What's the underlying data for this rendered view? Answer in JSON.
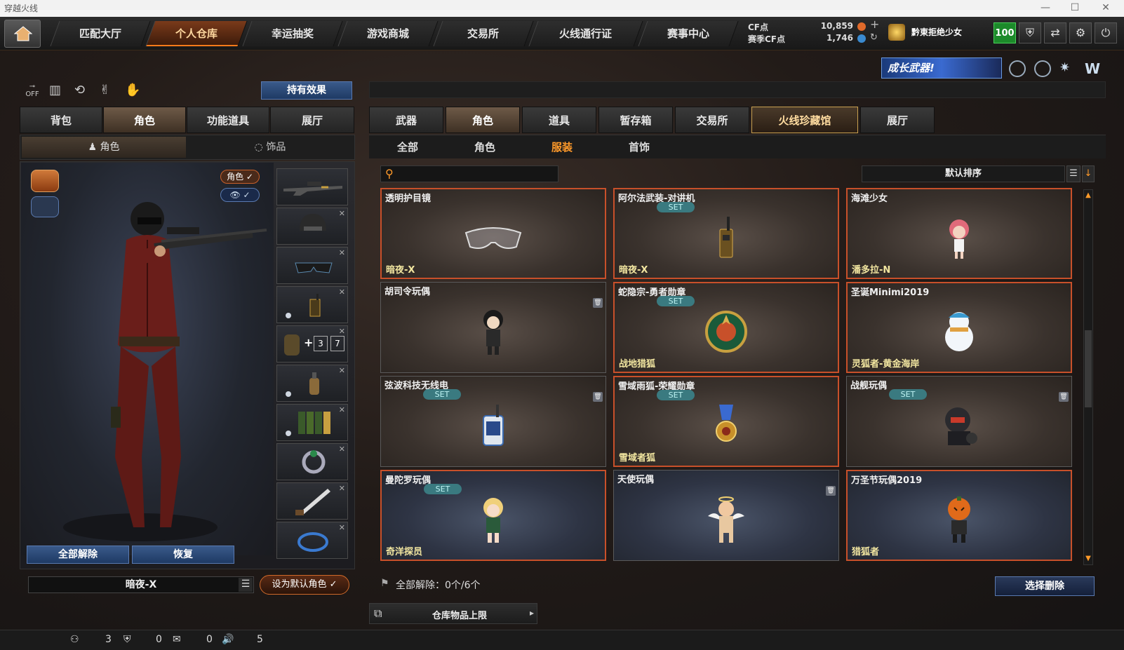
{
  "window": {
    "title": "穿越火线",
    "controls": [
      "—",
      "☐",
      "✕"
    ]
  },
  "nav": {
    "items": [
      "匹配大厅",
      "个人仓库",
      "幸运抽奖",
      "游戏商城",
      "交易所",
      "火线通行证",
      "赛事中心"
    ],
    "active_index": 1
  },
  "currency": {
    "cf_label": "CF点",
    "cf_value": "10,859",
    "season_label": "赛季CF点",
    "season_value": "1,746"
  },
  "user": {
    "name": "黔東拒绝少女",
    "level": "100"
  },
  "top_icons": [
    "shield-icon",
    "exit-icon",
    "settings-icon",
    "power-icon"
  ],
  "banner": {
    "text": "成长武器!"
  },
  "left": {
    "toolbar_icons": [
      "off-toggle-icon",
      "stats-icon",
      "rotate-icon",
      "pose-icon",
      "hand-icon"
    ],
    "hold_effect_label": "持有效果",
    "tabs": [
      "背包",
      "角色",
      "功能道具",
      "展厅"
    ],
    "active_tab": 1,
    "subtabs": [
      "角色",
      "饰品"
    ],
    "character_toggle": "角色 ✓",
    "release_all_label": "全部解除",
    "restore_label": "恢复",
    "character_name": "暗夜-X",
    "set_default_label": "设为默认角色 ✓",
    "slot_extras": {
      "plus": "+",
      "a": "3",
      "b": "7"
    }
  },
  "right": {
    "tabs": [
      "武器",
      "角色",
      "道具",
      "暂存箱",
      "交易所",
      "火线珍藏馆",
      "展厅"
    ],
    "active_tab": 1,
    "special_tab": 5,
    "subtabs": [
      "全部",
      "角色",
      "服装",
      "首饰"
    ],
    "active_subtab": 2,
    "search_placeholder": "",
    "sort_label": "默认排序",
    "items": [
      {
        "name": "透明护目镜",
        "owner": "暗夜-X",
        "set": "",
        "trash": false,
        "style": "red",
        "icon": "goggles-icon"
      },
      {
        "name": "阿尔法武装-对讲机",
        "owner": "暗夜-X",
        "set": "SET",
        "trash": false,
        "style": "red",
        "icon": "walkie-talkie-icon"
      },
      {
        "name": "海滩少女",
        "owner": "潘多拉-N",
        "set": "",
        "trash": false,
        "style": "red",
        "icon": "beach-girl-doll-icon"
      },
      {
        "name": "胡司令玩偶",
        "owner": "",
        "set": "",
        "trash": true,
        "style": "normal",
        "icon": "commander-doll-icon"
      },
      {
        "name": "蛇隐宗-勇者勋章",
        "owner": "战地猎狐",
        "set": "SET",
        "trash": false,
        "style": "red",
        "icon": "medal-icon"
      },
      {
        "name": "圣诞Minimi2019",
        "owner": "灵狐者-黄金海岸",
        "set": "",
        "trash": false,
        "style": "red",
        "icon": "snowman-icon"
      },
      {
        "name": "弦波科技无线电",
        "owner": "",
        "set": "SET",
        "trash": true,
        "style": "normal",
        "icon": "radio-icon"
      },
      {
        "name": "雪域雨狐-荣耀勋章",
        "owner": "雪域者狐",
        "set": "SET",
        "trash": false,
        "style": "red",
        "icon": "honor-medal-icon"
      },
      {
        "name": "战舰玩偶",
        "owner": "",
        "set": "SET",
        "trash": true,
        "style": "normal",
        "icon": "battleship-doll-icon"
      },
      {
        "name": "曼陀罗玩偶",
        "owner": "奇洋探员",
        "set": "SET",
        "trash": false,
        "style": "red-blue",
        "icon": "mandala-doll-icon"
      },
      {
        "name": "天使玩偶",
        "owner": "",
        "set": "",
        "trash": true,
        "style": "blue",
        "icon": "angel-doll-icon"
      },
      {
        "name": "万圣节玩偶2019",
        "owner": "猎狐者",
        "set": "",
        "trash": false,
        "style": "red-blue",
        "icon": "pumpkin-doll-icon"
      }
    ],
    "release_all_label": "全部解除：0个/6个",
    "select_delete_label": "选择删除",
    "storage_limit_label": "仓库物品上限"
  },
  "statusbar": {
    "count1": "3",
    "count2": "0",
    "count3": "0",
    "count4": "5"
  },
  "colors": {
    "accent": "#c8502a",
    "set_badge": "#3a7a80",
    "level_green": "#1c8a2a",
    "button_blue": "#1e3a64"
  }
}
